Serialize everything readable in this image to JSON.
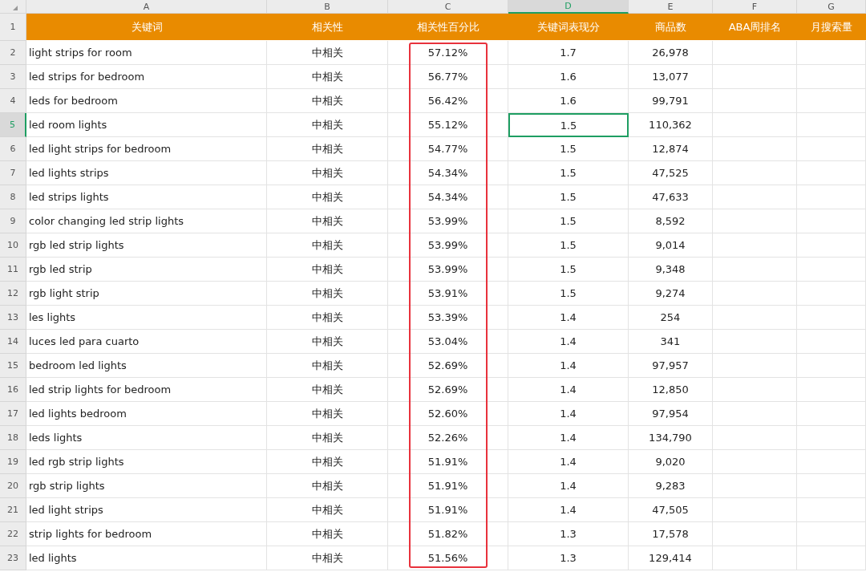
{
  "columns": [
    {
      "letter": "A",
      "header": "关键词",
      "selected": false,
      "highlighted": false
    },
    {
      "letter": "B",
      "header": "相关性",
      "selected": false,
      "highlighted": false
    },
    {
      "letter": "C",
      "header": "相关性百分比",
      "selected": false,
      "highlighted": true
    },
    {
      "letter": "D",
      "header": "关键词表现分",
      "selected": true,
      "highlighted": false
    },
    {
      "letter": "E",
      "header": "商品数",
      "selected": false,
      "highlighted": false
    },
    {
      "letter": "F",
      "header": "ABA周排名",
      "selected": false,
      "highlighted": false
    },
    {
      "letter": "G",
      "header": "月搜索量",
      "selected": false,
      "highlighted": false
    }
  ],
  "header_row_number": "1",
  "rows": [
    {
      "number": "2",
      "selected": false,
      "cells": [
        "light strips for room",
        "中相关",
        "57.12%",
        "1.7",
        "26,978"
      ]
    },
    {
      "number": "3",
      "selected": false,
      "cells": [
        "led strips for bedroom",
        "中相关",
        "56.77%",
        "1.6",
        "13,077"
      ]
    },
    {
      "number": "4",
      "selected": false,
      "cells": [
        "leds for bedroom",
        "中相关",
        "56.42%",
        "1.6",
        "99,791"
      ]
    },
    {
      "number": "5",
      "selected": true,
      "cells": [
        "led room lights",
        "中相关",
        "55.12%",
        "1.5",
        "110,362"
      ]
    },
    {
      "number": "6",
      "selected": false,
      "cells": [
        "led light strips for bedroom",
        "中相关",
        "54.77%",
        "1.5",
        "12,874"
      ]
    },
    {
      "number": "7",
      "selected": false,
      "cells": [
        "led lights strips",
        "中相关",
        "54.34%",
        "1.5",
        "47,525"
      ]
    },
    {
      "number": "8",
      "selected": false,
      "cells": [
        "led strips lights",
        "中相关",
        "54.34%",
        "1.5",
        "47,633"
      ]
    },
    {
      "number": "9",
      "selected": false,
      "cells": [
        "color changing led strip lights",
        "中相关",
        "53.99%",
        "1.5",
        "8,592"
      ]
    },
    {
      "number": "10",
      "selected": false,
      "cells": [
        "rgb led strip lights",
        "中相关",
        "53.99%",
        "1.5",
        "9,014"
      ]
    },
    {
      "number": "11",
      "selected": false,
      "cells": [
        "rgb led strip",
        "中相关",
        "53.99%",
        "1.5",
        "9,348"
      ]
    },
    {
      "number": "12",
      "selected": false,
      "cells": [
        "rgb light strip",
        "中相关",
        "53.91%",
        "1.5",
        "9,274"
      ]
    },
    {
      "number": "13",
      "selected": false,
      "cells": [
        "les lights",
        "中相关",
        "53.39%",
        "1.4",
        "254"
      ]
    },
    {
      "number": "14",
      "selected": false,
      "cells": [
        "luces led para cuarto",
        "中相关",
        "53.04%",
        "1.4",
        "341"
      ]
    },
    {
      "number": "15",
      "selected": false,
      "cells": [
        "bedroom led lights",
        "中相关",
        "52.69%",
        "1.4",
        "97,957"
      ]
    },
    {
      "number": "16",
      "selected": false,
      "cells": [
        "led strip lights for bedroom",
        "中相关",
        "52.69%",
        "1.4",
        "12,850"
      ]
    },
    {
      "number": "17",
      "selected": false,
      "cells": [
        "led lights bedroom",
        "中相关",
        "52.60%",
        "1.4",
        "97,954"
      ]
    },
    {
      "number": "18",
      "selected": false,
      "cells": [
        "leds lights",
        "中相关",
        "52.26%",
        "1.4",
        "134,790"
      ]
    },
    {
      "number": "19",
      "selected": false,
      "cells": [
        "led rgb strip lights",
        "中相关",
        "51.91%",
        "1.4",
        "9,020"
      ]
    },
    {
      "number": "20",
      "selected": false,
      "cells": [
        "rgb strip lights",
        "中相关",
        "51.91%",
        "1.4",
        "9,283"
      ]
    },
    {
      "number": "21",
      "selected": false,
      "cells": [
        "led light strips",
        "中相关",
        "51.91%",
        "1.4",
        "47,505"
      ]
    },
    {
      "number": "22",
      "selected": false,
      "cells": [
        "strip lights for bedroom",
        "中相关",
        "51.82%",
        "1.3",
        "17,578"
      ]
    },
    {
      "number": "23",
      "selected": false,
      "cells": [
        "led lights",
        "中相关",
        "51.56%",
        "1.3",
        "129,414"
      ]
    }
  ]
}
